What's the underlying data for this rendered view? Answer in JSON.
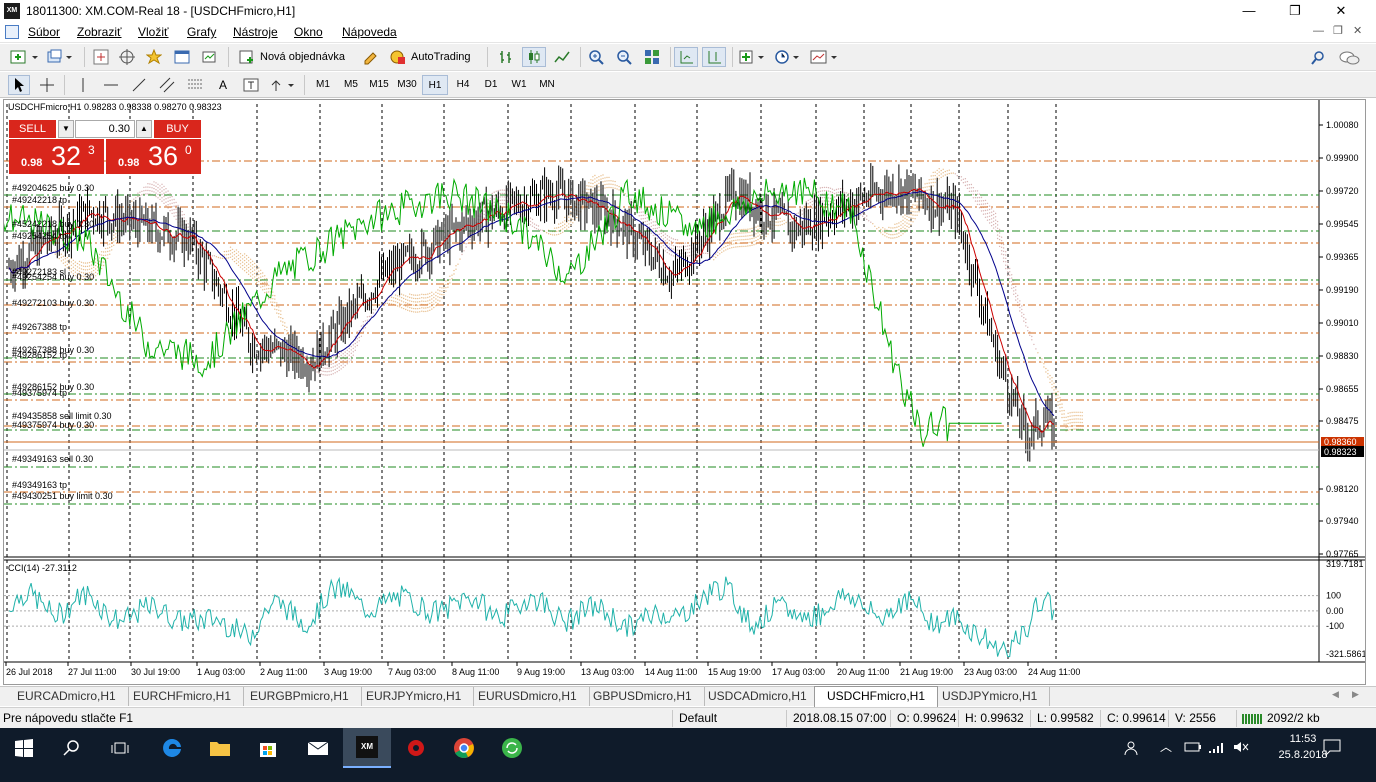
{
  "window": {
    "title": "18011300: XM.COM-Real 18 - [USDCHFmicro,H1]",
    "app_icon": "XM"
  },
  "menu": [
    "Súbor",
    "Zobraziť",
    "Vložiť",
    "Grafy",
    "Nástroje",
    "Okno",
    "Nápoveda"
  ],
  "toolbar": {
    "new_order": "Nová objednávka",
    "autotrading": "AutoTrading"
  },
  "timeframes": [
    "M1",
    "M5",
    "M15",
    "M30",
    "H1",
    "H4",
    "D1",
    "W1",
    "MN"
  ],
  "active_timeframe": "H1",
  "chart": {
    "header": "USDCHFmicro,H1  0.98283 0.98338 0.98270 0.98323",
    "sell_label": "SELL",
    "buy_label": "BUY",
    "lot": "0.30",
    "sell_price_small": "0.98",
    "sell_price_big": "32",
    "sell_price_sup": "3",
    "buy_price_small": "0.98",
    "buy_price_big": "36",
    "buy_price_sup": "0",
    "price_labels": [
      "1.00080",
      "0.99900",
      "0.99720",
      "0.99545",
      "0.99365",
      "0.99190",
      "0.99010",
      "0.98830",
      "0.98655",
      "0.98475",
      "0.98120",
      "0.97940",
      "0.97765"
    ],
    "current_bid": "0.98323",
    "current_ask": "0.98360",
    "orders": [
      "#49204625 buy 0.30",
      "#49242218 tp",
      "#45242218 buy 0.30",
      "#49254254 tp",
      "#49272183 sl",
      "#49254254 buy 0.30",
      "#49272103 buy 0.30",
      "#49267388 tp",
      "#49267388 buy 0.30",
      "#49286152 tp",
      "#49286152 buy 0.30",
      "#49375974 tp",
      "#49435858 sell limit 0.30",
      "#49375974 buy 0.30",
      "#49349163 sell 0.30",
      "#49349163 tp",
      "#49430251 buy limit 0.30"
    ],
    "cci_label": "CCI(14) -27.3112",
    "cci_axis": [
      "319.7181",
      "100",
      "0.00",
      "-100",
      "-321.5861"
    ],
    "time_labels": [
      "26 Jul 2018",
      "27 Jul 11:00",
      "30 Jul 19:00",
      "1 Aug 03:00",
      "2 Aug 11:00",
      "3 Aug 19:00",
      "7 Aug 03:00",
      "8 Aug 11:00",
      "9 Aug 19:00",
      "13 Aug 03:00",
      "14 Aug 11:00",
      "15 Aug 19:00",
      "17 Aug 03:00",
      "20 Aug 11:00",
      "21 Aug 19:00",
      "23 Aug 03:00",
      "24 Aug 11:00"
    ]
  },
  "tabs": [
    "EURCADmicro,H1",
    "EURCHFmicro,H1",
    "EURGBPmicro,H1",
    "EURJPYmicro,H1",
    "EURUSDmicro,H1",
    "GBPUSDmicro,H1",
    "USDCADmicro,H1",
    "USDCHFmicro,H1",
    "USDJPYmicro,H1"
  ],
  "active_tab": "USDCHFmicro,H1",
  "status": {
    "help": "Pre nápovedu stlačte F1",
    "profile": "Default",
    "datetime": "2018.08.15 07:00",
    "open": "O: 0.99624",
    "high": "H: 0.99632",
    "low": "L: 0.99582",
    "close": "C: 0.99614",
    "volume": "V: 2556",
    "traffic": "2092/2 kb"
  },
  "taskbar": {
    "time": "11:53",
    "date": "25.8.2018"
  },
  "colors": {
    "sell": "#d9261c",
    "buy": "#d9261c",
    "close_line": "#00aa00",
    "tenkan": "#cc0000",
    "kijun": "#00008b",
    "cci": "#20b2aa",
    "current_price_bg": "#cc3300"
  }
}
